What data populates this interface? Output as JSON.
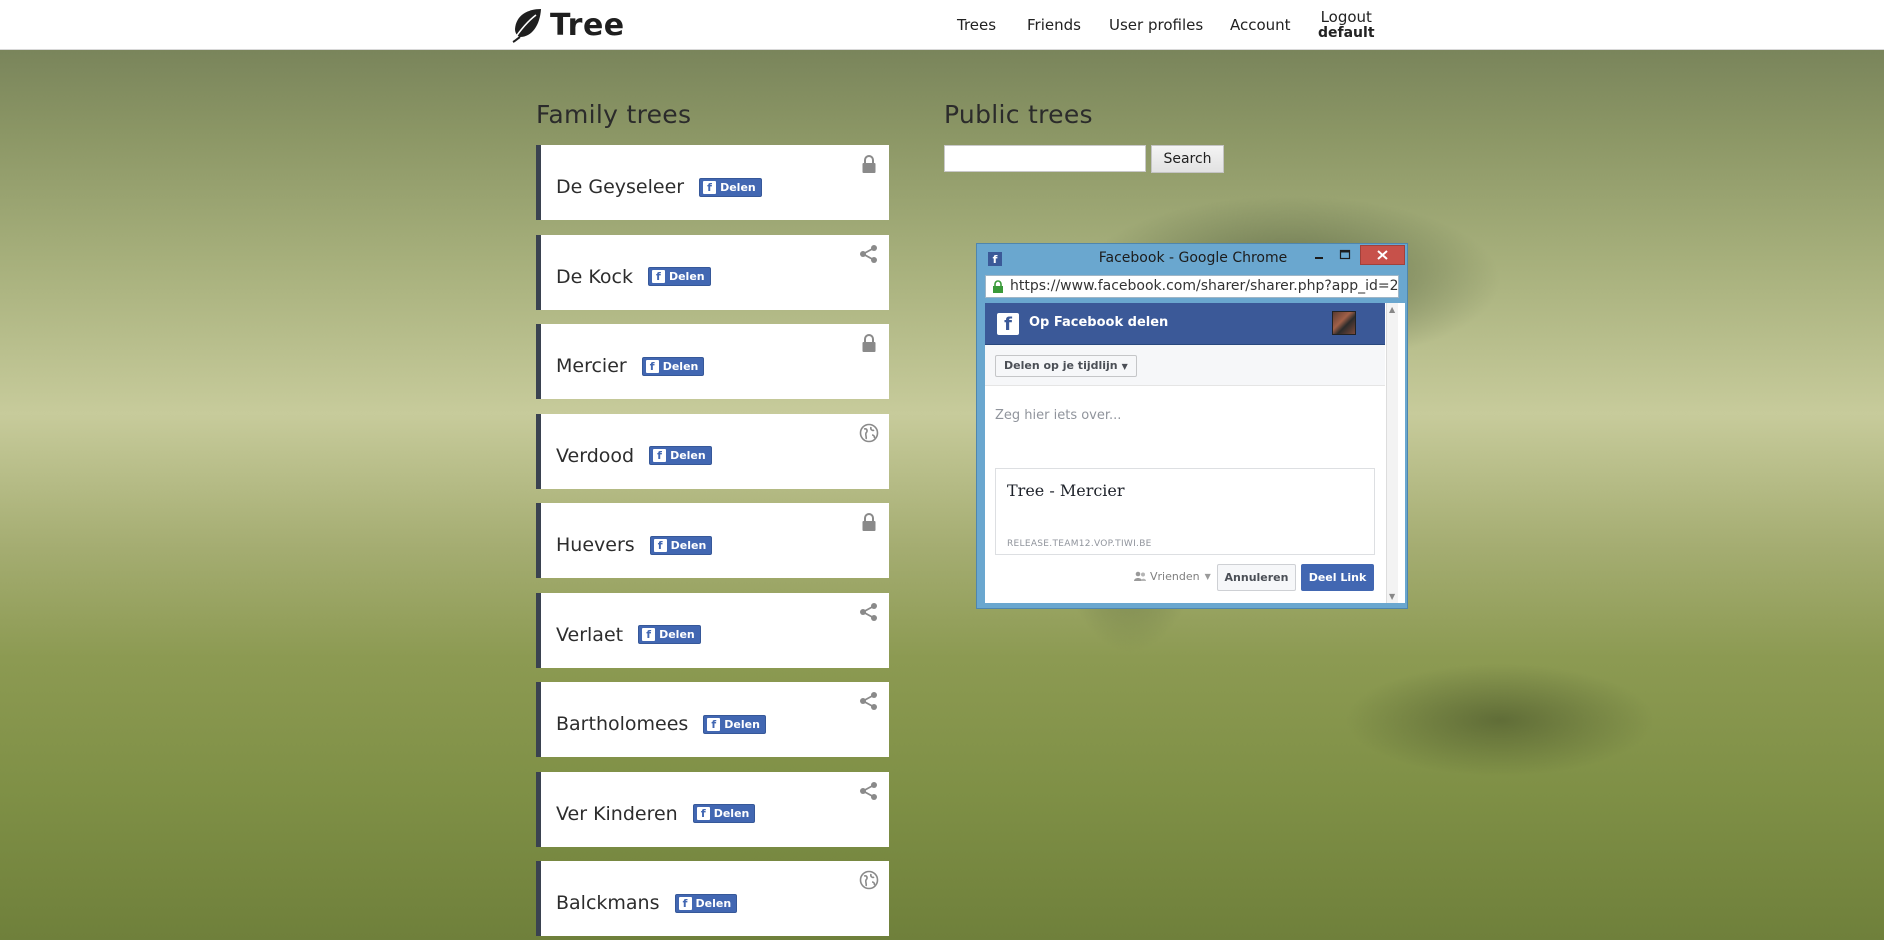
{
  "app": {
    "logo_text": "Tree"
  },
  "nav": {
    "items": [
      {
        "label": "Trees"
      },
      {
        "label": "Friends"
      },
      {
        "label": "User profiles"
      },
      {
        "label": "Account"
      }
    ],
    "logout_label": "Logout",
    "username": "default"
  },
  "family_trees": {
    "title": "Family trees",
    "share_label": "Delen",
    "items": [
      {
        "name": "De Geyseleer",
        "icon": "lock-icon"
      },
      {
        "name": "De Kock",
        "icon": "share-icon"
      },
      {
        "name": "Mercier",
        "icon": "lock-icon"
      },
      {
        "name": "Verdood",
        "icon": "globe-icon"
      },
      {
        "name": "Huevers",
        "icon": "lock-icon"
      },
      {
        "name": "Verlaet",
        "icon": "share-icon"
      },
      {
        "name": "Bartholomees",
        "icon": "share-icon"
      },
      {
        "name": "Ver Kinderen",
        "icon": "share-icon"
      },
      {
        "name": "Balckmans",
        "icon": "globe-icon"
      }
    ]
  },
  "public_trees": {
    "title": "Public trees",
    "search_value": "",
    "search_button": "Search"
  },
  "popup": {
    "window_title": "Facebook - Google Chrome",
    "url": "https://www.facebook.com/sharer/sharer.php?app_id=2",
    "header": "Op Facebook delen",
    "share_target": "Delen op je tijdlijn",
    "comment_placeholder": "Zeg hier iets over...",
    "preview_title": "Tree - Mercier",
    "preview_domain": "RELEASE.TEAM12.VOP.TIWI.BE",
    "audience": "Vrienden",
    "cancel_label": "Annuleren",
    "post_label": "Deel Link"
  },
  "colors": {
    "card_border": "#3a4250",
    "facebook_blue": "#4267b2",
    "popup_frame": "#6aa7cf",
    "close_red": "#c7514a"
  }
}
